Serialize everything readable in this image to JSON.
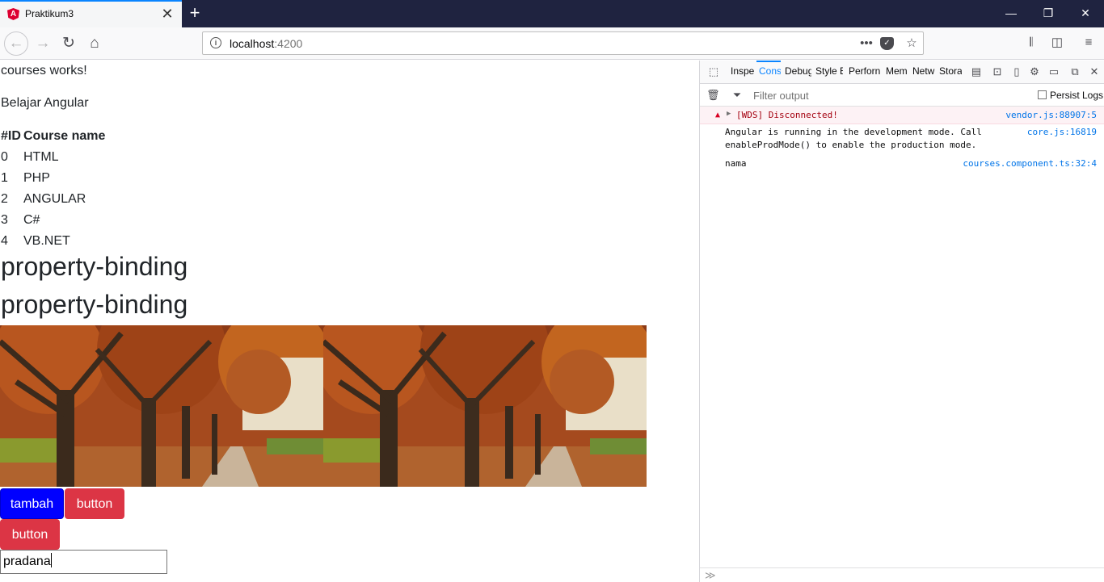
{
  "browser": {
    "tab_title": "Praktikum3",
    "tab_favicon": "A",
    "new_tab_symbol": "+",
    "close_symbol": "✕",
    "url_host": "localhost",
    "url_port": ":4200",
    "window_controls": {
      "minimize": "—",
      "restore": "❐",
      "close": "✕"
    }
  },
  "page": {
    "heading_text": "courses works!",
    "subtitle": "Belajar Angular",
    "table": {
      "headers": [
        "#ID",
        "Course name"
      ],
      "rows": [
        [
          "0",
          "HTML"
        ],
        [
          "1",
          "PHP"
        ],
        [
          "2",
          "ANGULAR"
        ],
        [
          "3",
          "C#"
        ],
        [
          "4",
          "VB.NET"
        ]
      ]
    },
    "binding_title_1": "property-binding",
    "binding_title_2": "property-binding",
    "buttons": {
      "tambah": "tambah",
      "button_1": "button",
      "button_2": "button"
    },
    "input_value": "pradana"
  },
  "devtools": {
    "tabs": [
      "Inspe",
      "Cons",
      "Debug",
      "Style E",
      "Perforn",
      "Mem",
      "Netw",
      "Stora"
    ],
    "filter_placeholder": "Filter output",
    "persist_logs": "Persist Logs",
    "messages": [
      {
        "type": "error",
        "text": "[WDS] Disconnected!",
        "source": "vendor.js:88907:5"
      },
      {
        "type": "log",
        "line1": "Angular is running in the development mode. Call",
        "line2": "enableProdMode() to enable the production mode.",
        "source": "core.js:16819"
      },
      {
        "type": "log",
        "text": "nama",
        "source": "courses.component.ts:32:4"
      }
    ],
    "prompt_symbol": "≫"
  },
  "colors": {
    "tambah_button": "#0000ff",
    "danger_button": "#dc3545",
    "accent": "#0a84ff",
    "error_text": "#a4000f"
  }
}
